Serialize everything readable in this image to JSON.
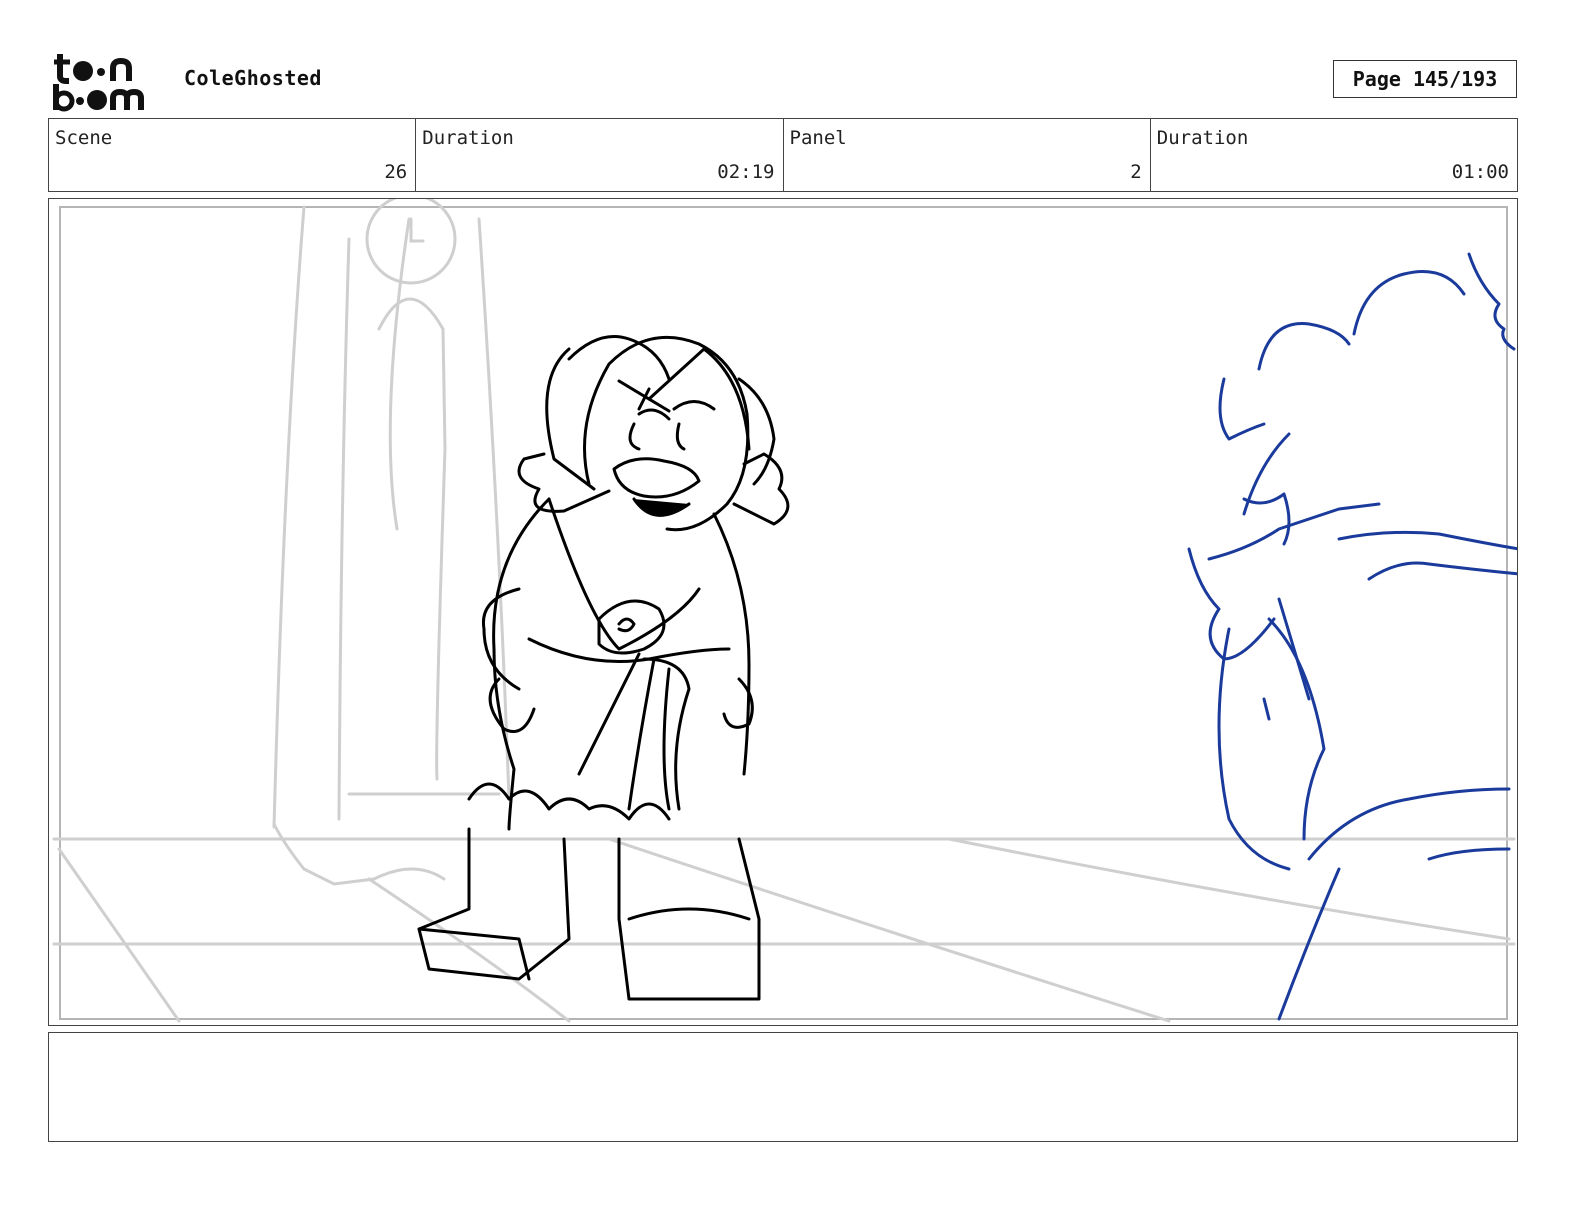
{
  "header": {
    "logo_alt": "toon boom",
    "project_title": "ColeGhosted",
    "page_indicator": "Page 145/193"
  },
  "info_bar": {
    "scene_label": "Scene",
    "scene_value": "26",
    "scene_duration_label": "Duration",
    "scene_duration_value": "02:19",
    "panel_label": "Panel",
    "panel_value": "2",
    "panel_duration_label": "Duration",
    "panel_duration_value": "01:00"
  },
  "panel": {
    "drawing": "rough storyboard sketch",
    "ink_colors": {
      "background": "#cccccc",
      "character": "#000000",
      "foreground_character": "#1a3a9c"
    }
  },
  "notes": {
    "text": ""
  }
}
